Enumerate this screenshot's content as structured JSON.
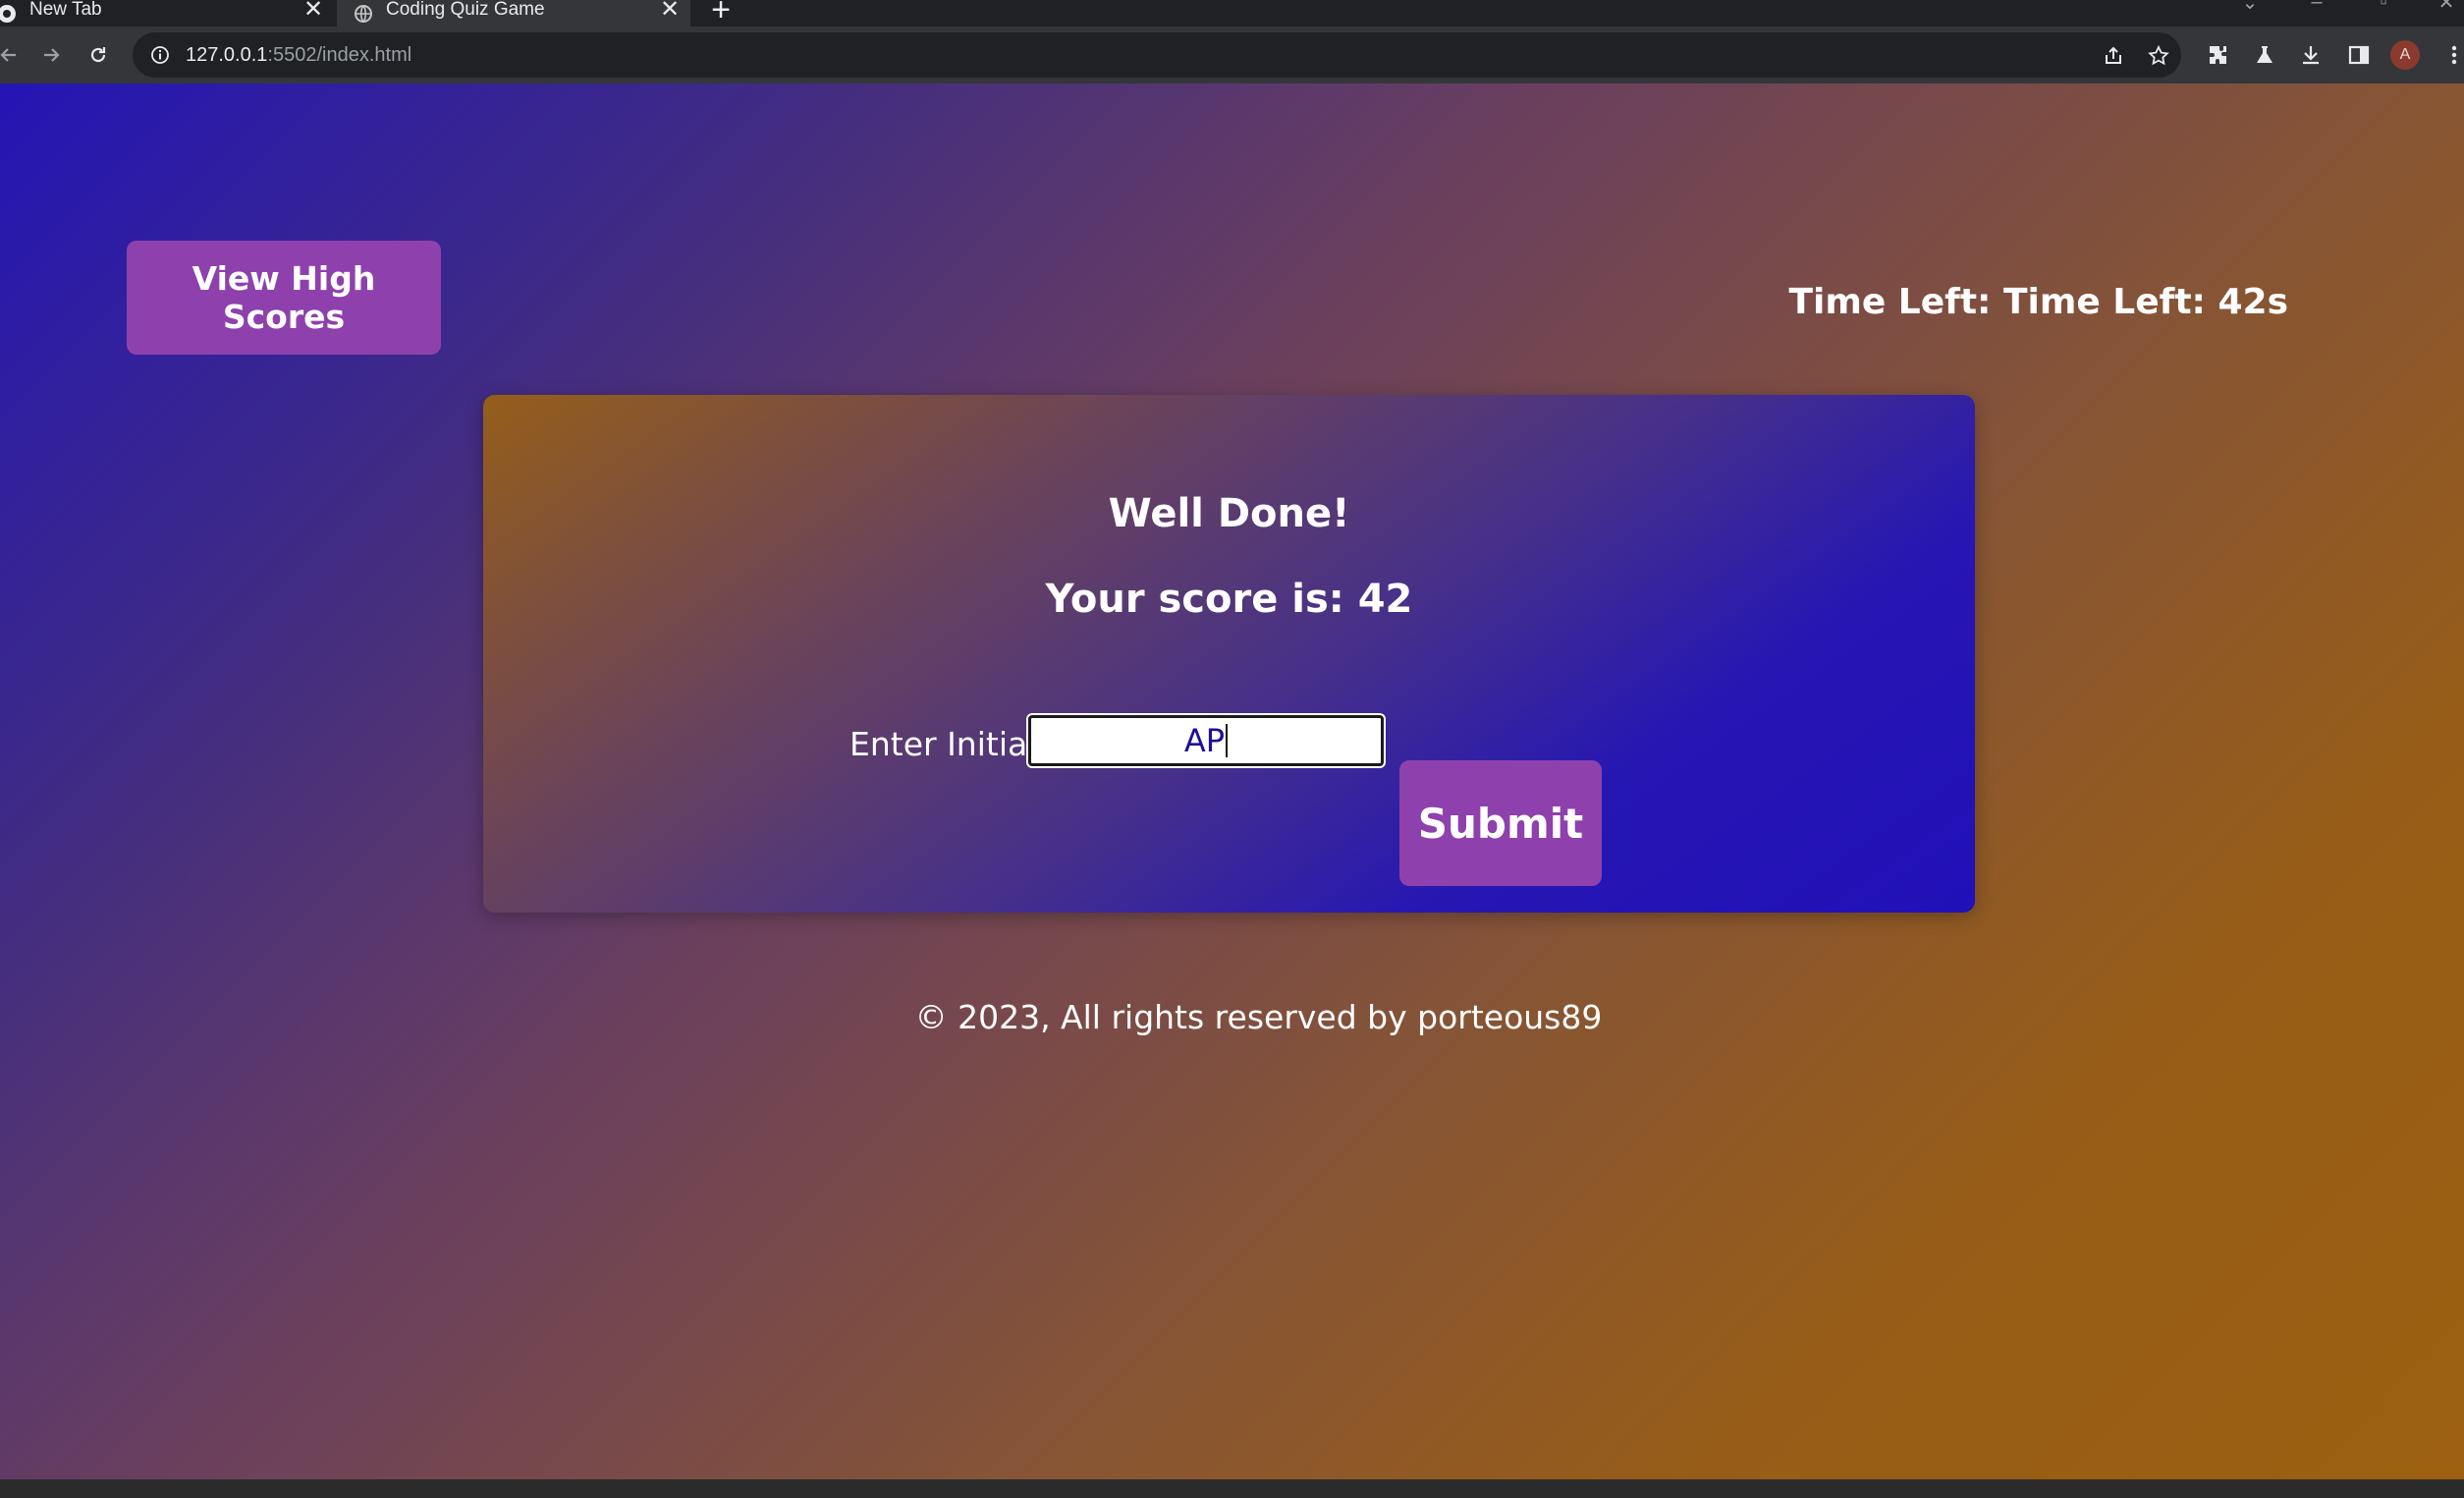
{
  "browser": {
    "tabs": [
      {
        "title": "New Tab",
        "icon": "chrome-icon",
        "active": false
      },
      {
        "title": "Coding Quiz Game",
        "icon": "globe-icon",
        "active": true
      }
    ],
    "new_tab_symbol": "+",
    "url_host": "127.0.0.1",
    "url_rest": ":5502/index.html",
    "avatar_letter": "A",
    "close_symbol": "✕"
  },
  "page": {
    "high_scores_label": "View High Scores",
    "timer_text": "Time Left: Time Left: 42s",
    "card": {
      "title": "Well Done!",
      "score_text": "Your score is: 42",
      "initials_label": "Enter Initials:",
      "initials_value": "AP",
      "submit_label": "Submit"
    },
    "footer_text": "© 2023, All rights reserved by porteous89"
  },
  "colors": {
    "button_purple": "#8e41ad",
    "gradient_blue": "#2415b5",
    "gradient_orange": "#9c6010",
    "input_text": "#1c0f99"
  }
}
